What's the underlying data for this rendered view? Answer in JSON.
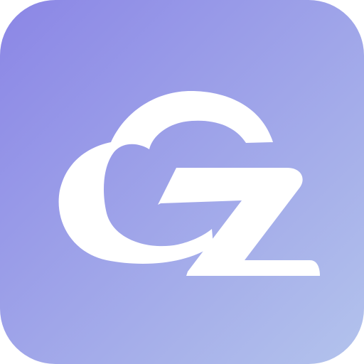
{
  "app_icon": {
    "icon": "cloud-g-z-logo-icon",
    "background_gradient": {
      "start_color": "#8B86E6",
      "end_color": "#B3C3EC"
    },
    "glyph_color": "#FFFFFF"
  }
}
